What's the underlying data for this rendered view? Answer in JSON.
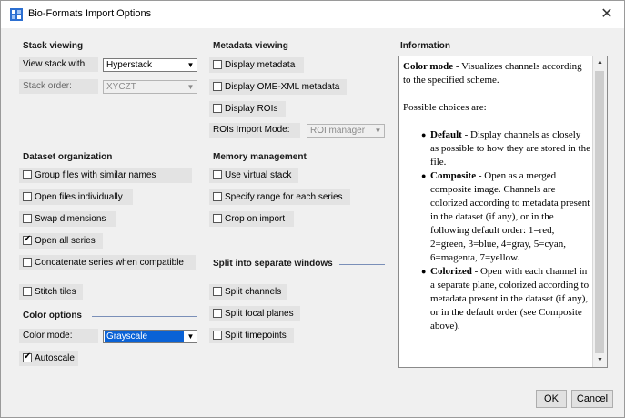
{
  "window": {
    "title": "Bio-Formats Import Options",
    "close_glyph": "✕"
  },
  "stack_viewing": {
    "heading": "Stack viewing",
    "view_label": "View stack with:",
    "view_value": "Hyperstack",
    "order_label": "Stack order:",
    "order_value": "XYCZT"
  },
  "dataset_organization": {
    "heading": "Dataset organization",
    "options": [
      {
        "label": "Group files with similar names",
        "checked": false
      },
      {
        "label": "Open files individually",
        "checked": false
      },
      {
        "label": "Swap dimensions",
        "checked": false
      },
      {
        "label": "Open all series",
        "checked": true
      },
      {
        "label": "Concatenate series when compatible",
        "checked": false
      },
      {
        "label": "Stitch tiles",
        "checked": false
      }
    ]
  },
  "color_options": {
    "heading": "Color options",
    "mode_label": "Color mode:",
    "mode_value": "Grayscale",
    "autoscale_label": "Autoscale",
    "autoscale_checked": true
  },
  "metadata_viewing": {
    "heading": "Metadata viewing",
    "options": [
      {
        "label": "Display metadata",
        "checked": false
      },
      {
        "label": "Display OME-XML metadata",
        "checked": false
      },
      {
        "label": "Display ROIs",
        "checked": false
      }
    ],
    "rois_label": "ROIs Import Mode:",
    "rois_value": "ROI manager"
  },
  "memory_management": {
    "heading": "Memory management",
    "options": [
      {
        "label": "Use virtual stack",
        "checked": false
      },
      {
        "label": "Specify range for each series",
        "checked": false
      },
      {
        "label": "Crop on import",
        "checked": false
      }
    ]
  },
  "split_windows": {
    "heading": "Split into separate windows",
    "options": [
      {
        "label": "Split channels",
        "checked": false
      },
      {
        "label": "Split focal planes",
        "checked": false
      },
      {
        "label": "Split timepoints",
        "checked": false
      }
    ]
  },
  "information": {
    "heading": "Information",
    "title": "Color mode",
    "intro": " - Visualizes channels according to the specified scheme.",
    "choices_heading": "Possible choices are:",
    "choices": [
      {
        "name": "Default",
        "text": " - Display channels as closely as possible to how they are stored in the file."
      },
      {
        "name": "Composite",
        "text": " - Open as a merged composite image. Channels are colorized according to metadata present in the dataset (if any), or in the following default order: 1=red, 2=green, 3=blue, 4=gray, 5=cyan, 6=magenta, 7=yellow."
      },
      {
        "name": "Colorized",
        "text": " - Open with each channel in a separate plane, colorized according to metadata present in the dataset (if any), or in the default order (see Composite above)."
      }
    ]
  },
  "buttons": {
    "ok": "OK",
    "cancel": "Cancel"
  },
  "icons": {
    "app": "bio-formats-app-icon",
    "dropdown": "chevron-down-icon",
    "scroll_up": "scroll-up-icon",
    "scroll_down": "scroll-down-icon"
  },
  "colors": {
    "section_line": "#7a8fb8",
    "selection": "#0a62d6",
    "accent_icon": "#2c6fd1"
  }
}
